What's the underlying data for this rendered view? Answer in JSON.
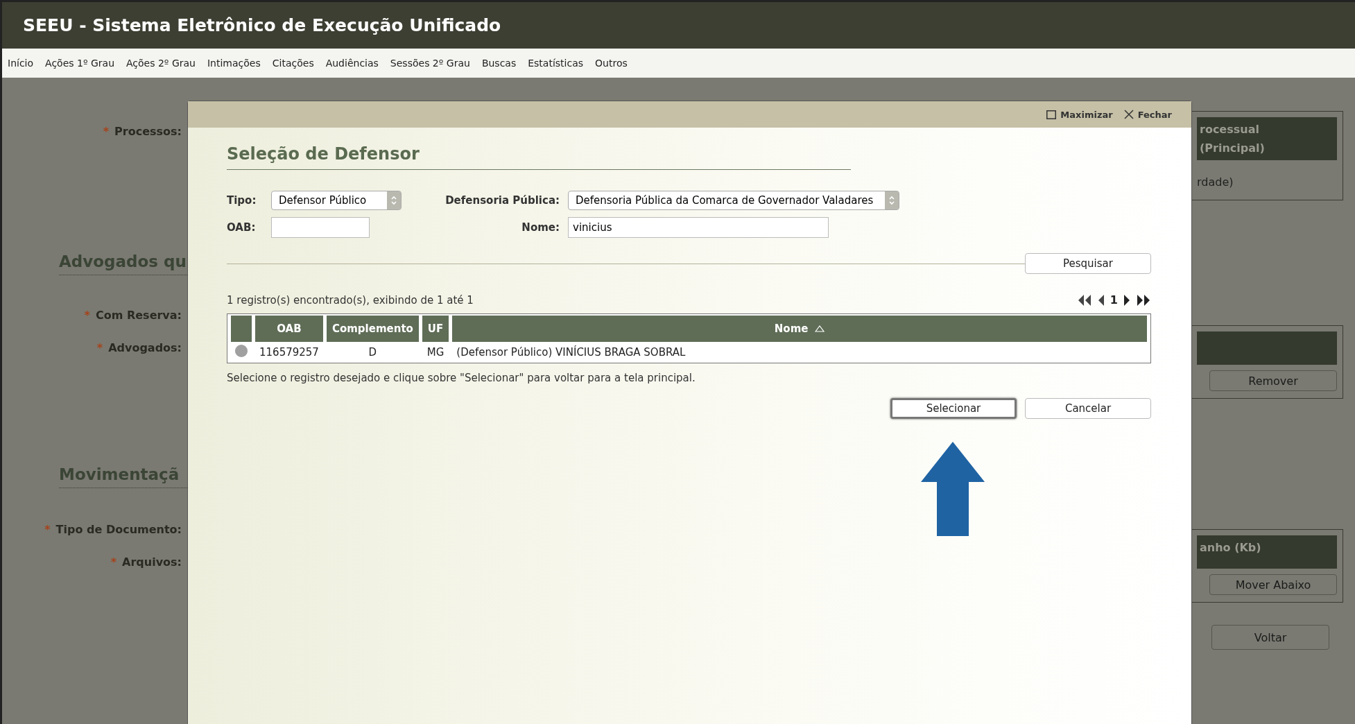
{
  "app": {
    "title": "SEEU - Sistema Eletrônico de Execução Unificado"
  },
  "menu": [
    {
      "label": "Início"
    },
    {
      "label": "Ações 1º Grau"
    },
    {
      "label": "Ações 2º Grau"
    },
    {
      "label": "Intimações"
    },
    {
      "label": "Citações"
    },
    {
      "label": "Audiências"
    },
    {
      "label": "Sessões 2º Grau"
    },
    {
      "label": "Buscas"
    },
    {
      "label": "Estatísticas"
    },
    {
      "label": "Outros"
    }
  ],
  "background": {
    "left": [
      {
        "kind": "label",
        "text": "Processos:",
        "marker": "*"
      },
      {
        "kind": "heading",
        "text": "Advogados qu"
      },
      {
        "kind": "label",
        "text": "Com Reserva:",
        "marker": "*"
      },
      {
        "kind": "label",
        "text": "Advogados:",
        "marker": "*"
      },
      {
        "kind": "heading",
        "text": "Movimentaçã"
      },
      {
        "kind": "label",
        "text": "Tipo de Documento:",
        "marker": "*"
      },
      {
        "kind": "label",
        "text": "Arquivos:",
        "marker": "*"
      }
    ],
    "right": [
      {
        "header": [
          "rocessual",
          "(Principal)"
        ],
        "body_text": "rdade)"
      },
      {
        "button": "Remover"
      },
      {
        "header": [
          "anho (Kb)"
        ],
        "button": "Mover Abaixo"
      }
    ],
    "back_button": "Voltar"
  },
  "dialog": {
    "controls": [
      {
        "kind": "maximize",
        "label": "Maximizar"
      },
      {
        "kind": "close",
        "label": "Fechar"
      }
    ],
    "title": "Seleção de Defensor",
    "tipo": {
      "label": "Tipo:",
      "value": "Defensor Público"
    },
    "defensoria": {
      "label": "Defensoria Pública:",
      "value": "Defensoria Pública da Comarca de Governador Valadares"
    },
    "oab": {
      "label": "OAB:"
    },
    "nome": {
      "label": "Nome:",
      "value": "vinicius"
    },
    "search_button": "Pesquisar",
    "summary": "1 registro(s) encontrado(s), exibindo de 1 até 1",
    "pagination": {
      "current": "1"
    },
    "columns": [
      {
        "label": "OAB",
        "sorted": false
      },
      {
        "label": "Complemento",
        "sorted": false
      },
      {
        "label": "UF",
        "sorted": false
      },
      {
        "label": "Nome",
        "sorted": true
      }
    ],
    "rows": [
      {
        "selected": false,
        "oab": "116579257",
        "complemento": "D",
        "uf": "MG",
        "nome": "(Defensor Público) VINÍCIUS BRAGA SOBRAL"
      }
    ],
    "hint": "Selecione o registro desejado e clique sobre \"Selecionar\" para voltar para a tela principal.",
    "buttons": [
      {
        "label": "Selecionar",
        "focused": true
      },
      {
        "label": "Cancelar",
        "focused": false
      }
    ]
  }
}
